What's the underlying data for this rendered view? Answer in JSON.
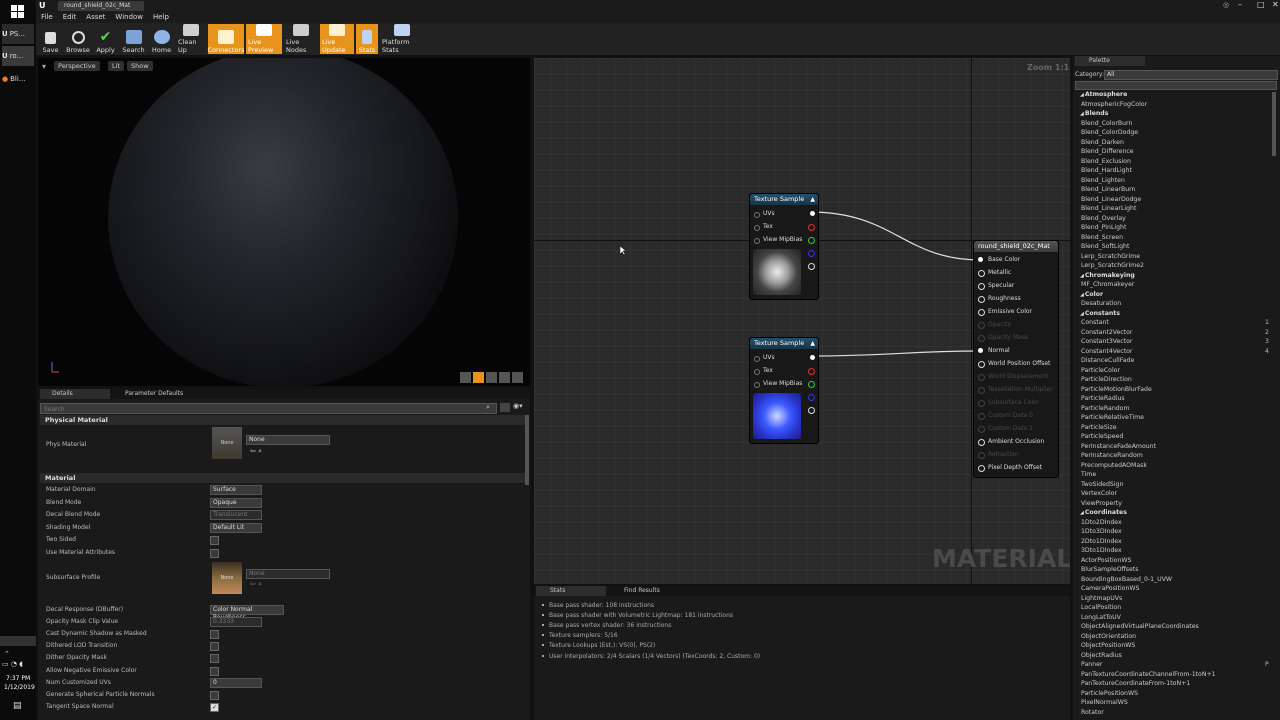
{
  "window": {
    "title": "round_shield_02c_Mat"
  },
  "taskbar": {
    "items": [
      "PS...",
      "ro...",
      "Bli..."
    ],
    "time": "7:37 PM",
    "date": "1/12/2019"
  },
  "menu": [
    "File",
    "Edit",
    "Asset",
    "Window",
    "Help"
  ],
  "toolbar": [
    {
      "label": "Save",
      "active": false
    },
    {
      "label": "Browse",
      "active": false
    },
    {
      "label": "Apply",
      "active": false
    },
    {
      "label": "Search",
      "active": false
    },
    {
      "label": "Home",
      "active": false
    },
    {
      "label": "Clean Up",
      "active": false
    },
    {
      "label": "Connectors",
      "active": true
    },
    {
      "label": "Live Preview",
      "active": true
    },
    {
      "label": "Live Nodes",
      "active": false
    },
    {
      "label": "Live Update",
      "active": true
    },
    {
      "label": "Stats",
      "active": true
    },
    {
      "label": "Platform Stats",
      "active": false
    }
  ],
  "viewport": {
    "buttons": [
      "Perspective",
      "Lit",
      "Show"
    ]
  },
  "details": {
    "tabs": [
      "Details",
      "Parameter Defaults"
    ],
    "search_placeholder": "Search",
    "physical_section": "Physical Material",
    "phys_label": "Phys Material",
    "phys_value": "None",
    "thumb_none": "None",
    "material_section": "Material",
    "rows": [
      {
        "label": "Material Domain",
        "type": "dd",
        "value": "Surface"
      },
      {
        "label": "Blend Mode",
        "type": "dd",
        "value": "Opaque"
      },
      {
        "label": "Decal Blend Mode",
        "type": "dd",
        "value": "Translucent",
        "disabled": true
      },
      {
        "label": "Shading Model",
        "type": "dd",
        "value": "Default Lit"
      },
      {
        "label": "Two Sided",
        "type": "cb",
        "value": false
      },
      {
        "label": "Use Material Attributes",
        "type": "cb",
        "value": false
      }
    ],
    "subsurface_label": "Subsurface Profile",
    "subsurface_value": "None",
    "rows2": [
      {
        "label": "Decal Response (DBuffer)",
        "type": "dd",
        "value": "Color Normal Roughness"
      },
      {
        "label": "Opacity Mask Clip Value",
        "type": "num",
        "value": "0.3333",
        "disabled": true
      },
      {
        "label": "Cast Dynamic Shadow as Masked",
        "type": "cb",
        "value": false
      },
      {
        "label": "Dithered LOD Transition",
        "type": "cb",
        "value": false
      },
      {
        "label": "Dither Opacity Mask",
        "type": "cb",
        "value": false
      },
      {
        "label": "Allow Negative Emissive Color",
        "type": "cb",
        "value": false
      },
      {
        "label": "Num Customized UVs",
        "type": "num",
        "value": "0"
      },
      {
        "label": "Generate Spherical Particle Normals",
        "type": "cb",
        "value": false
      },
      {
        "label": "Tangent Space Normal",
        "type": "cb",
        "value": true
      }
    ]
  },
  "graph": {
    "zoom": "Zoom 1:1",
    "watermark": "MATERIAL",
    "nodes": [
      {
        "title": "Texture Sample",
        "pins": [
          "UVs",
          "Tex",
          "View MipBias"
        ]
      },
      {
        "title": "Texture Sample",
        "pins": [
          "UVs",
          "Tex",
          "View MipBias"
        ]
      }
    ],
    "result": {
      "title": "round_shield_02c_Mat",
      "pins": [
        {
          "label": "Base Color",
          "enabled": true
        },
        {
          "label": "Metallic",
          "enabled": true
        },
        {
          "label": "Specular",
          "enabled": true
        },
        {
          "label": "Roughness",
          "enabled": true
        },
        {
          "label": "Emissive Color",
          "enabled": true
        },
        {
          "label": "Opacity",
          "enabled": false
        },
        {
          "label": "Opacity Mask",
          "enabled": false
        },
        {
          "label": "Normal",
          "enabled": true
        },
        {
          "label": "World Position Offset",
          "enabled": true
        },
        {
          "label": "World Displacement",
          "enabled": false
        },
        {
          "label": "Tessellation Multiplier",
          "enabled": false
        },
        {
          "label": "Subsurface Color",
          "enabled": false
        },
        {
          "label": "Custom Data 0",
          "enabled": false
        },
        {
          "label": "Custom Data 1",
          "enabled": false
        },
        {
          "label": "Ambient Occlusion",
          "enabled": true
        },
        {
          "label": "Refraction",
          "enabled": false
        },
        {
          "label": "Pixel Depth Offset",
          "enabled": true
        }
      ]
    }
  },
  "stats": {
    "tabs": [
      "Stats",
      "Find Results"
    ],
    "lines": [
      "Base pass shader: 108 instructions",
      "Base pass shader with Volumetric Lightmap: 181 instructions",
      "Base pass vertex shader: 36 instructions",
      "Texture samplers: 5/16",
      "Texture Lookups (Est.): VS(0), PS(2)",
      "User interpolators: 2/4 Scalars (1/4 Vectors) (TexCoords: 2, Custom: 0)"
    ]
  },
  "palette": {
    "tab": "Palette",
    "category_label": "Category:",
    "category_value": "All",
    "items": [
      {
        "t": "Atmosphere",
        "c": true
      },
      {
        "t": "AtmosphericFogColor"
      },
      {
        "t": "Blends",
        "c": true
      },
      {
        "t": "Blend_ColorBurn"
      },
      {
        "t": "Blend_ColorDodge"
      },
      {
        "t": "Blend_Darken"
      },
      {
        "t": "Blend_Difference"
      },
      {
        "t": "Blend_Exclusion"
      },
      {
        "t": "Blend_HardLight"
      },
      {
        "t": "Blend_Lighten"
      },
      {
        "t": "Blend_LinearBurn"
      },
      {
        "t": "Blend_LinearDodge"
      },
      {
        "t": "Blend_LinearLight"
      },
      {
        "t": "Blend_Overlay"
      },
      {
        "t": "Blend_PinLight"
      },
      {
        "t": "Blend_Screen"
      },
      {
        "t": "Blend_SoftLight"
      },
      {
        "t": "Lerp_ScratchGrime"
      },
      {
        "t": "Lerp_ScratchGrime2"
      },
      {
        "t": "Chromakeying",
        "c": true
      },
      {
        "t": "MF_Chromakeyer"
      },
      {
        "t": "Color",
        "c": true
      },
      {
        "t": "Desaturation"
      },
      {
        "t": "Constants",
        "c": true
      },
      {
        "t": "Constant",
        "k": "1"
      },
      {
        "t": "Constant2Vector",
        "k": "2"
      },
      {
        "t": "Constant3Vector",
        "k": "3"
      },
      {
        "t": "Constant4Vector",
        "k": "4"
      },
      {
        "t": "DistanceCullFade"
      },
      {
        "t": "ParticleColor"
      },
      {
        "t": "ParticleDirection"
      },
      {
        "t": "ParticleMotionBlurFade"
      },
      {
        "t": "ParticleRadius"
      },
      {
        "t": "ParticleRandom"
      },
      {
        "t": "ParticleRelativeTime"
      },
      {
        "t": "ParticleSize"
      },
      {
        "t": "ParticleSpeed"
      },
      {
        "t": "PerInstanceFadeAmount"
      },
      {
        "t": "PerInstanceRandom"
      },
      {
        "t": "PrecomputedAOMask"
      },
      {
        "t": "Time"
      },
      {
        "t": "TwoSidedSign"
      },
      {
        "t": "VertexColor"
      },
      {
        "t": "ViewProperty"
      },
      {
        "t": "Coordinates",
        "c": true
      },
      {
        "t": "1Dto2DIndex"
      },
      {
        "t": "1Dto3DIndex"
      },
      {
        "t": "2Dto1DIndex"
      },
      {
        "t": "3Dto1DIndex"
      },
      {
        "t": "ActorPositionWS"
      },
      {
        "t": "BlurSampleOffsets"
      },
      {
        "t": "BoundingBoxBased_0-1_UVW"
      },
      {
        "t": "CameraPositionWS"
      },
      {
        "t": "LightmapUVs"
      },
      {
        "t": "LocalPosition"
      },
      {
        "t": "LongLatToUV"
      },
      {
        "t": "ObjectAlignedVirtualPlaneCoordinates"
      },
      {
        "t": "ObjectOrientation"
      },
      {
        "t": "ObjectPositionWS"
      },
      {
        "t": "ObjectRadius"
      },
      {
        "t": "Panner",
        "k": "P"
      },
      {
        "t": "PanTextureCoordinateChannelFrom-1toN+1"
      },
      {
        "t": "PanTextureCoordinateFrom-1toN+1"
      },
      {
        "t": "ParticlePositionWS"
      },
      {
        "t": "PixelNormalWS"
      },
      {
        "t": "Rotator"
      }
    ]
  },
  "colors": {
    "accent": "#e8941c",
    "node_header": "#24506a",
    "wire": "#e0e0e0"
  }
}
